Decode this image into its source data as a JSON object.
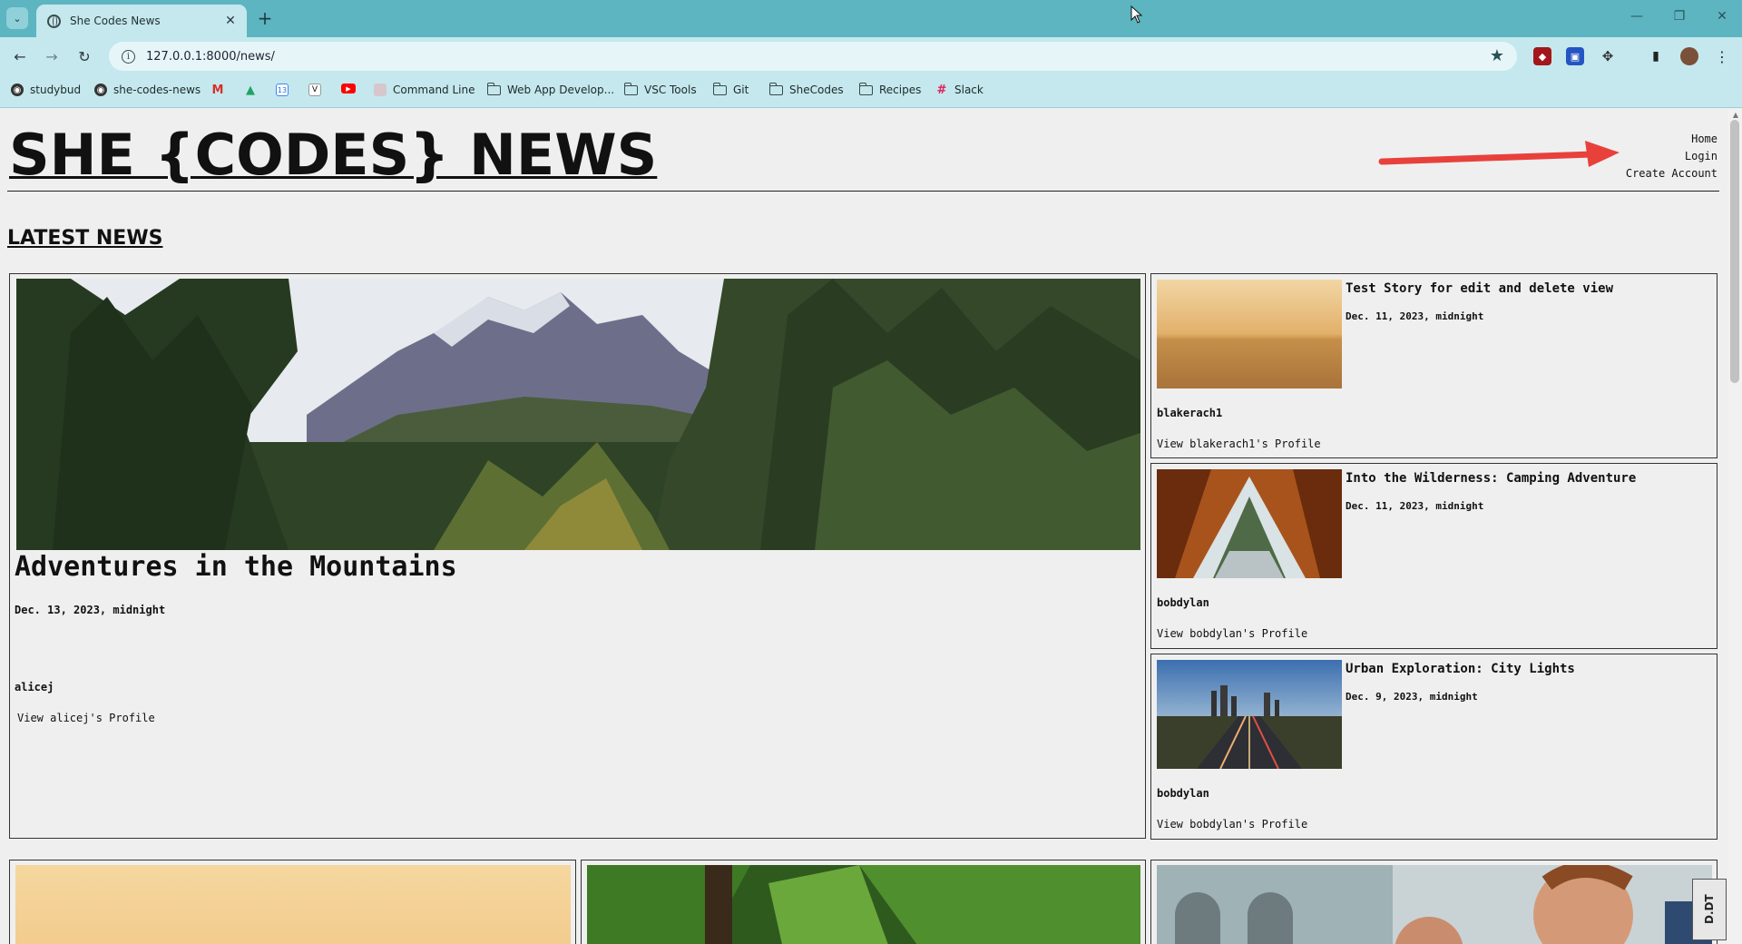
{
  "browser": {
    "tab_title": "She Codes News",
    "url": "127.0.0.1:8000/news/",
    "bookmarks": [
      {
        "label": "studybud",
        "icon": "globe-icon"
      },
      {
        "label": "she-codes-news",
        "icon": "globe-icon"
      },
      {
        "label": "",
        "icon": "gmail-icon"
      },
      {
        "label": "",
        "icon": "drive-icon"
      },
      {
        "label": "",
        "icon": "calendar-icon"
      },
      {
        "label": "",
        "icon": "v-icon"
      },
      {
        "label": "",
        "icon": "youtube-icon"
      },
      {
        "label": "Command Line",
        "icon": "page-icon"
      },
      {
        "label": "Web App Develop...",
        "icon": "folder-icon"
      },
      {
        "label": "VSC Tools",
        "icon": "folder-icon"
      },
      {
        "label": "Git",
        "icon": "folder-icon"
      },
      {
        "label": "SheCodes",
        "icon": "folder-icon"
      },
      {
        "label": "Recipes",
        "icon": "folder-icon"
      },
      {
        "label": "Slack",
        "icon": "slack-icon"
      }
    ]
  },
  "site": {
    "title": "SHE {CODES} NEWS",
    "nav": {
      "home": "Home",
      "login": "Login",
      "create_account": "Create Account"
    },
    "section_heading": "LATEST NEWS"
  },
  "stories": {
    "featured": {
      "title": "Adventures in the Mountains",
      "date": "Dec. 13, 2023, midnight",
      "author": "alicej",
      "profile_link": "View alicej's Profile"
    },
    "side": [
      {
        "title": "Test Story for edit and delete view",
        "date": "Dec. 11, 2023, midnight",
        "author": "blakerach1",
        "profile_link": "View blakerach1's Profile"
      },
      {
        "title": "Into the Wilderness: Camping Adventure",
        "date": "Dec. 11, 2023, midnight",
        "author": "bobdylan",
        "profile_link": "View bobdylan's Profile"
      },
      {
        "title": "Urban Exploration: City Lights",
        "date": "Dec. 9, 2023, midnight",
        "author": "bobdylan",
        "profile_link": "View bobdylan's Profile"
      }
    ]
  },
  "overlay_badge": "D.DT",
  "colors": {
    "tabstrip": "#5cb5c1",
    "toolbar": "#c4e8ed",
    "arrow": "#e8413c",
    "page_bg": "#efefef"
  }
}
